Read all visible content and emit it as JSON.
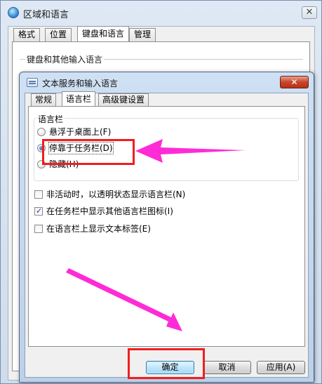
{
  "outer_window": {
    "title": "区域和语言",
    "close_glyph": "✕",
    "tabs": [
      {
        "label": "格式"
      },
      {
        "label": "位置"
      },
      {
        "label": "键盘和语言"
      },
      {
        "label": "管理"
      }
    ],
    "group_label": "键盘和其他输入语言"
  },
  "dialog": {
    "title": "文本服务和输入语言",
    "close_glyph": "✕",
    "tabs": [
      {
        "label": "常规"
      },
      {
        "label": "语言栏"
      },
      {
        "label": "高级键设置"
      }
    ],
    "langbar_group_label": "语言栏",
    "radios": [
      {
        "label": "悬浮于桌面上(F)",
        "checked": false
      },
      {
        "label": "停靠于任务栏(D)",
        "checked": true
      },
      {
        "label": "隐藏(H)",
        "checked": false
      }
    ],
    "checkboxes": [
      {
        "label": "非活动时，以透明状态显示语言栏(N)",
        "checked": false
      },
      {
        "label": "在任务栏中显示其他语言栏图标(I)",
        "checked": true
      },
      {
        "label": "在语言栏上显示文本标签(E)",
        "checked": false
      }
    ],
    "buttons": {
      "ok": "确定",
      "cancel": "取消",
      "apply": "应用(A)"
    }
  },
  "annotation_colors": {
    "highlight_box": "#f01e1e",
    "arrow": "#ff2bd6"
  }
}
